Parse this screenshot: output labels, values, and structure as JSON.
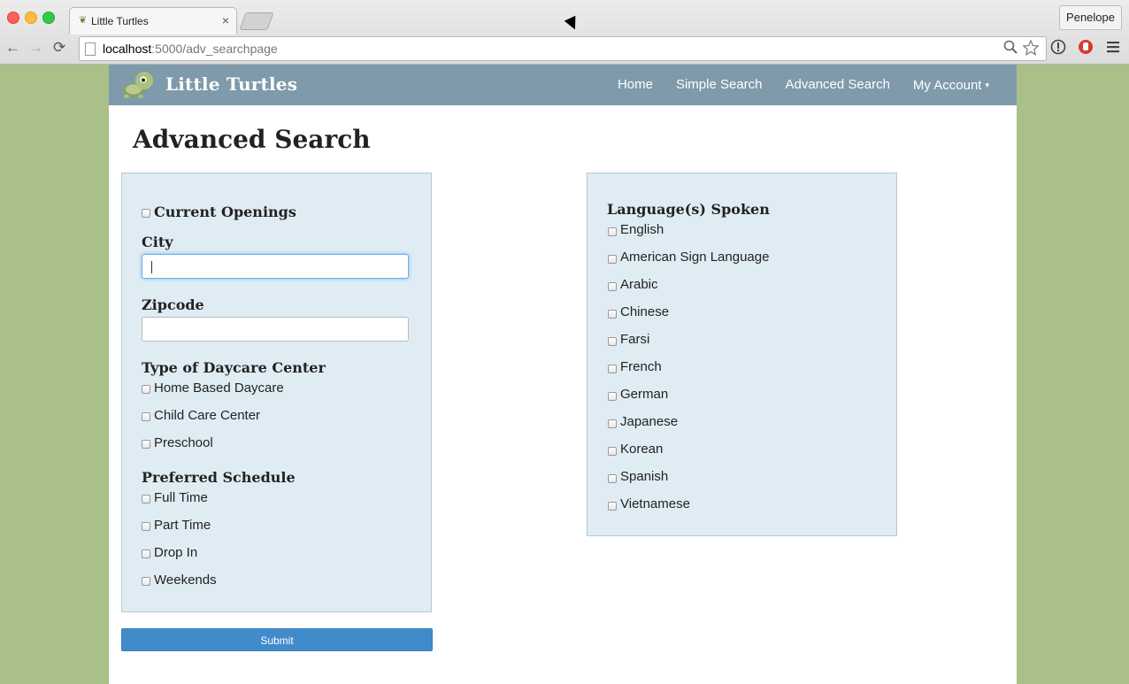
{
  "browser": {
    "tab_title": "Little Turtles",
    "tab_close": "×",
    "profile_name": "Penelope",
    "url_host": "localhost",
    "url_path": ":5000/adv_searchpage",
    "back": "←",
    "forward": "→",
    "reload": "⟳"
  },
  "navbar": {
    "brand": "Little Turtles",
    "links": [
      "Home",
      "Simple Search",
      "Advanced Search",
      "My Account"
    ],
    "dropdown_caret": "▾"
  },
  "page": {
    "title": "Advanced Search"
  },
  "left_panel": {
    "current_openings_label": "Current Openings",
    "city_label": "City",
    "city_value": "",
    "zipcode_label": "Zipcode",
    "zipcode_value": "",
    "daycare_type_heading": "Type of Daycare Center",
    "daycare_types": [
      "Home Based Daycare",
      "Child Care Center",
      "Preschool"
    ],
    "schedule_heading": "Preferred Schedule",
    "schedules": [
      "Full Time",
      "Part Time",
      "Drop In",
      "Weekends"
    ]
  },
  "right_panel": {
    "languages_heading": "Language(s) Spoken",
    "languages": [
      "English",
      "American Sign Language",
      "Arabic",
      "Chinese",
      "Farsi",
      "French",
      "German",
      "Japanese",
      "Korean",
      "Spanish",
      "Vietnamese"
    ]
  },
  "submit_label": "Submit",
  "colors": {
    "background": "#a9c188",
    "navbar": "#7e9aab",
    "panel": "#e0ecf3",
    "submit": "#428bca"
  }
}
